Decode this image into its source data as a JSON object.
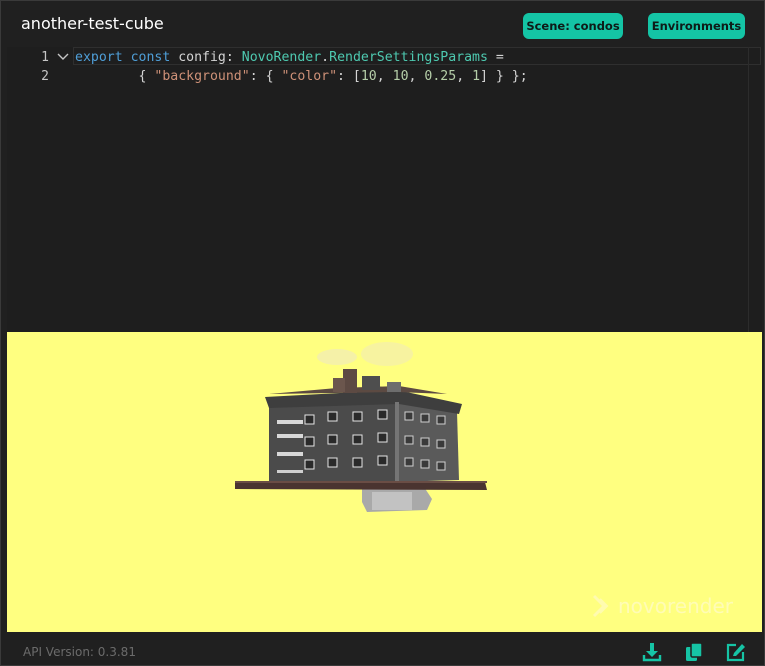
{
  "header": {
    "title": "another-test-cube",
    "scene_button": "Scene: condos",
    "environments_button": "Environments"
  },
  "editor": {
    "line_numbers": [
      "1",
      "2"
    ],
    "line1": {
      "t1": "export",
      "t2": " ",
      "t3": "const",
      "t4": " config: ",
      "t5": "NovoRender",
      "t6": ".",
      "t7": "RenderSettingsParams",
      "t8": " ="
    },
    "line2": {
      "indent": "        { ",
      "k1": "\"background\"",
      "p1": ": { ",
      "k2": "\"color\"",
      "p2": ": [",
      "n1": "10",
      "c1": ", ",
      "n2": "10",
      "c2": ", ",
      "n3": "0.25",
      "c3": ", ",
      "n4": "1",
      "p3": "] } };"
    }
  },
  "viewport": {
    "background_color": "#ffff80",
    "watermark": "novorender"
  },
  "footer": {
    "api_version": "API Version: 0.3.81",
    "icons": [
      "download-icon",
      "copy-icon",
      "edit-icon"
    ]
  },
  "colors": {
    "accent": "#14c4a5",
    "keyword": "#4f9fd8",
    "type": "#4ec9b0",
    "string": "#ce9178",
    "number": "#b5cea8"
  }
}
